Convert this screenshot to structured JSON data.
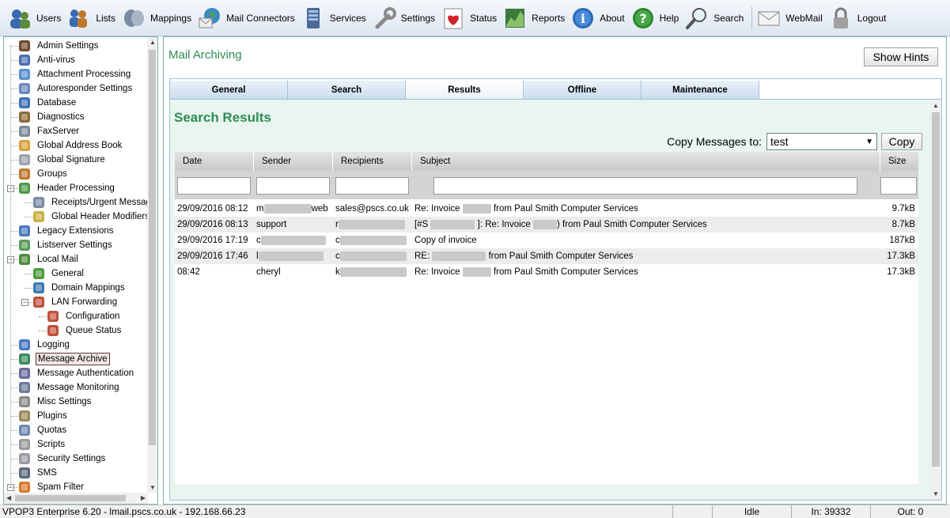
{
  "toolbar": [
    {
      "id": "users",
      "label": "Users",
      "icon": "users-icon"
    },
    {
      "id": "lists",
      "label": "Lists",
      "icon": "lists-icon"
    },
    {
      "id": "mappings",
      "label": "Mappings",
      "icon": "mappings-icon"
    },
    {
      "id": "mail-connectors",
      "label": "Mail Connectors",
      "icon": "mail-connectors-icon"
    },
    {
      "id": "services",
      "label": "Services",
      "icon": "services-icon"
    },
    {
      "id": "settings",
      "label": "Settings",
      "icon": "wrench-icon"
    },
    {
      "id": "status",
      "label": "Status",
      "icon": "heart-icon"
    },
    {
      "id": "reports",
      "label": "Reports",
      "icon": "reports-icon"
    },
    {
      "id": "about",
      "label": "About",
      "icon": "info-icon"
    },
    {
      "id": "help",
      "label": "Help",
      "icon": "help-icon"
    },
    {
      "id": "search",
      "label": "Search",
      "icon": "magnifier-icon"
    },
    {
      "id": "webmail",
      "label": "WebMail",
      "icon": "envelope-icon"
    },
    {
      "id": "logout",
      "label": "Logout",
      "icon": "padlock-icon"
    }
  ],
  "tree": [
    {
      "label": "Admin Settings",
      "level": 0,
      "icon": "admin-icon",
      "color": "#6b4a2f"
    },
    {
      "label": "Anti-virus",
      "level": 0,
      "icon": "shield-icon",
      "color": "#4a6fb0"
    },
    {
      "label": "Attachment Processing",
      "level": 0,
      "icon": "paperclip-icon",
      "color": "#5a8fd0"
    },
    {
      "label": "Autoresponder Settings",
      "level": 0,
      "icon": "gears-icon",
      "color": "#6c88b8"
    },
    {
      "label": "Database",
      "level": 0,
      "icon": "database-icon",
      "color": "#3d6fb5"
    },
    {
      "label": "Diagnostics",
      "level": 0,
      "icon": "doctor-icon",
      "color": "#8a6a3a"
    },
    {
      "label": "FaxServer",
      "level": 0,
      "icon": "fax-icon",
      "color": "#7a8a9a"
    },
    {
      "label": "Global Address Book",
      "level": 0,
      "icon": "address-book-icon",
      "color": "#d8a13a"
    },
    {
      "label": "Global Signature",
      "level": 0,
      "icon": "signature-icon",
      "color": "#9aa2ad"
    },
    {
      "label": "Groups",
      "level": 0,
      "icon": "groups-icon",
      "color": "#c0782a"
    },
    {
      "label": "Header Processing",
      "level": 0,
      "icon": "header-icon",
      "color": "#4a9a4a",
      "expander": "minus"
    },
    {
      "label": "Receipts/Urgent Messages",
      "level": 1,
      "icon": "receipt-icon",
      "color": "#7a8aa0"
    },
    {
      "label": "Global Header Modifiers",
      "level": 1,
      "icon": "header-modifier-icon",
      "color": "#c8b040"
    },
    {
      "label": "Legacy Extensions",
      "level": 0,
      "icon": "puzzle-icon",
      "color": "#4a78c0"
    },
    {
      "label": "Listserver Settings",
      "level": 0,
      "icon": "listserver-icon",
      "color": "#5a9a5a"
    },
    {
      "label": "Local Mail",
      "level": 0,
      "icon": "local-mail-icon",
      "color": "#4a8a3a",
      "expander": "minus"
    },
    {
      "label": "General",
      "level": 1,
      "icon": "general-icon",
      "color": "#4a9a3a"
    },
    {
      "label": "Domain Mappings",
      "level": 1,
      "icon": "globe-icon",
      "color": "#3a7ab0"
    },
    {
      "label": "LAN Forwarding",
      "level": 1,
      "icon": "lan-forwarding-icon",
      "color": "#c0503a",
      "expander": "minus"
    },
    {
      "label": "Configuration",
      "level": 2,
      "icon": "configuration-icon",
      "color": "#c0503a"
    },
    {
      "label": "Queue Status",
      "level": 2,
      "icon": "queue-status-icon",
      "color": "#c0503a"
    },
    {
      "label": "Logging",
      "level": 0,
      "icon": "logging-icon",
      "color": "#4a78c0"
    },
    {
      "label": "Message Archive",
      "level": 0,
      "icon": "archive-icon",
      "color": "#3a8a5a",
      "selected": true
    },
    {
      "label": "Message Authentication",
      "level": 0,
      "icon": "authentication-icon",
      "color": "#6a6a9a"
    },
    {
      "label": "Message Monitoring",
      "level": 0,
      "icon": "monitoring-icon",
      "color": "#6a7a9a"
    },
    {
      "label": "Misc Settings",
      "level": 0,
      "icon": "misc-icon",
      "color": "#8a8a8a"
    },
    {
      "label": "Plugins",
      "level": 0,
      "icon": "plug-icon",
      "color": "#9a8a5a"
    },
    {
      "label": "Quotas",
      "level": 0,
      "icon": "quota-icon",
      "color": "#6a8ab0"
    },
    {
      "label": "Scripts",
      "level": 0,
      "icon": "script-icon",
      "color": "#9a9a9a"
    },
    {
      "label": "Security Settings",
      "level": 0,
      "icon": "lock-icon",
      "color": "#9a9aa5"
    },
    {
      "label": "SMS",
      "level": 0,
      "icon": "phone-icon",
      "color": "#5a6a7a"
    },
    {
      "label": "Spam Filter",
      "level": 0,
      "icon": "spam-icon",
      "color": "#d87a2a",
      "expander": "minus"
    }
  ],
  "main": {
    "title": "Mail Archiving",
    "show_hints_label": "Show Hints",
    "tabs": [
      {
        "label": "General",
        "active": false
      },
      {
        "label": "Search",
        "active": false
      },
      {
        "label": "Results",
        "active": true
      },
      {
        "label": "Offline",
        "active": false
      },
      {
        "label": "Maintenance",
        "active": false
      }
    ],
    "results_title": "Search Results",
    "copy_label": "Copy Messages to:",
    "copy_target": "test",
    "copy_button": "Copy",
    "columns": [
      "Date",
      "Sender",
      "Recipients",
      "Subject",
      "Size"
    ],
    "rows": [
      {
        "date": "29/09/2016 08:12",
        "sender": "m",
        "sender_tail": "web",
        "recipients": "sales@pscs.co.uk",
        "subject_pre": "Re: Invoice",
        "subject_post": "from Paul Smith Computer Services",
        "size": "9.7kB"
      },
      {
        "date": "29/09/2016 08:13",
        "sender": "support",
        "sender_tail": "",
        "recipients": "r",
        "subject_pre": "[#S",
        "subject_post": "]: Re: Invoice",
        "subject_post2": ") from Paul Smith Computer Services",
        "size": "8.7kB"
      },
      {
        "date": "29/09/2016 17:19",
        "sender": "c",
        "sender_tail": "",
        "recipients": "c",
        "subject_pre": "Copy of invoice",
        "subject_post": "",
        "size": "187kB"
      },
      {
        "date": "29/09/2016 17:46",
        "sender": "l",
        "sender_tail": "",
        "recipients": "c",
        "subject_pre": "RE:",
        "subject_post": "from Paul Smith Computer Services",
        "size": "17.3kB"
      },
      {
        "date": "08:42",
        "sender": "cheryl",
        "sender_tail": "",
        "recipients": "k",
        "subject_pre": "Re: Invoice",
        "subject_post": "from Paul Smith Computer Services",
        "size": "17.3kB"
      }
    ]
  },
  "statusbar": {
    "app": "VPOP3 Enterprise 6.20 - lmail.pscs.co.uk - 192.168.66.23",
    "state": "Idle",
    "in": "In: 39332",
    "out": "Out: 0"
  }
}
